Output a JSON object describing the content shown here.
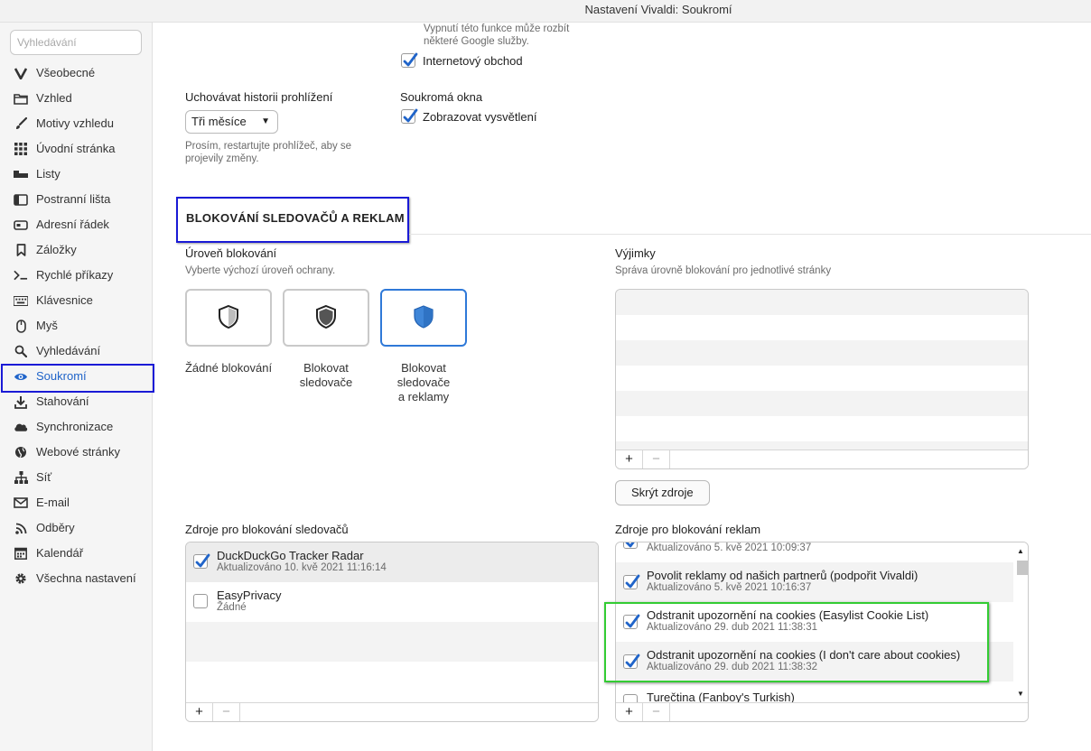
{
  "window": {
    "title": "Nastavení Vivaldi: Soukromí"
  },
  "sidebar": {
    "search_placeholder": "Vyhledávání",
    "items": [
      {
        "label": "Všeobecné",
        "icon": "vivaldi-logo-icon"
      },
      {
        "label": "Vzhled",
        "icon": "folder-icon"
      },
      {
        "label": "Motivy vzhledu",
        "icon": "brush-icon"
      },
      {
        "label": "Úvodní stránka",
        "icon": "grid-icon"
      },
      {
        "label": "Listy",
        "icon": "tabs-icon"
      },
      {
        "label": "Postranní lišta",
        "icon": "sidebar-panel-icon"
      },
      {
        "label": "Adresní řádek",
        "icon": "address-bar-icon"
      },
      {
        "label": "Záložky",
        "icon": "bookmark-icon"
      },
      {
        "label": "Rychlé příkazy",
        "icon": "quick-commands-icon"
      },
      {
        "label": "Klávesnice",
        "icon": "keyboard-icon"
      },
      {
        "label": "Myš",
        "icon": "mouse-icon"
      },
      {
        "label": "Vyhledávání",
        "icon": "search-icon"
      },
      {
        "label": "Soukromí",
        "icon": "eye-icon",
        "active": true
      },
      {
        "label": "Stahování",
        "icon": "download-icon"
      },
      {
        "label": "Synchronizace",
        "icon": "cloud-icon"
      },
      {
        "label": "Webové stránky",
        "icon": "globe-icon"
      },
      {
        "label": "Síť",
        "icon": "network-icon"
      },
      {
        "label": "E-mail",
        "icon": "mail-icon"
      },
      {
        "label": "Odběry",
        "icon": "rss-icon"
      },
      {
        "label": "Kalendář",
        "icon": "calendar-icon"
      },
      {
        "label": "Všechna nastavení",
        "icon": "gear-icon"
      }
    ]
  },
  "top": {
    "google_note_line1": "Vypnutí této funkce může rozbít",
    "google_note_line2": "některé Google služby.",
    "internet_shop_label": "Internetový obchod",
    "history_label": "Uchovávat historii prohlížení",
    "history_value": "Tři měsíce",
    "restart_note_line1": "Prosím, restartujte prohlížeč, aby se",
    "restart_note_line2": "projevily změny.",
    "private_windows_label": "Soukromá okna",
    "show_explanation_label": "Zobrazovat vysvětlení"
  },
  "blocking": {
    "section_title": "BLOKOVÁNÍ SLEDOVAČŮ A REKLAM",
    "level_label": "Úroveň blokování",
    "level_desc": "Vyberte výchozí úroveň ochrany.",
    "options": [
      {
        "line1": "Žádné blokování",
        "line2": "",
        "line3": ""
      },
      {
        "line1": "Blokovat",
        "line2": "sledovače",
        "line3": ""
      },
      {
        "line1": "Blokovat",
        "line2": "sledovače",
        "line3": "a reklamy"
      }
    ],
    "exceptions_label": "Výjimky",
    "exceptions_desc": "Správa úrovně blokování pro jednotlivé stránky",
    "hide_sources_button": "Skrýt zdroje",
    "add_symbol": "+",
    "remove_symbol": "−",
    "tracker_sources_label": "Zdroje pro blokování sledovačů",
    "tracker_sources": [
      {
        "name": "DuckDuckGo Tracker Radar",
        "updated": "Aktualizováno 10. kvě 2021 11:16:14",
        "checked": true
      },
      {
        "name": "EasyPrivacy",
        "updated": "Žádné",
        "checked": false
      }
    ],
    "ad_sources_label": "Zdroje pro blokování reklam",
    "ad_sources": [
      {
        "name": "",
        "updated": "Aktualizováno 5. kvě 2021 10:09:37",
        "checked": true
      },
      {
        "name": "Povolit reklamy od našich partnerů (podpořit Vivaldi)",
        "updated": "Aktualizováno 5. kvě 2021 10:16:37",
        "checked": true
      },
      {
        "name": "Odstranit upozornění na cookies (Easylist Cookie List)",
        "updated": "Aktualizováno 29. dub 2021 11:38:31",
        "checked": true
      },
      {
        "name": "Odstranit upozornění na cookies (I don't care about cookies)",
        "updated": "Aktualizováno 29. dub 2021 11:38:32",
        "checked": true
      },
      {
        "name": "Turečtina (Fanboy's Turkish)",
        "updated": "",
        "checked": false
      }
    ]
  },
  "colors": {
    "accent": "#2064c9",
    "highlight_blue": "#1a1ad6",
    "highlight_green": "#33cc33"
  }
}
